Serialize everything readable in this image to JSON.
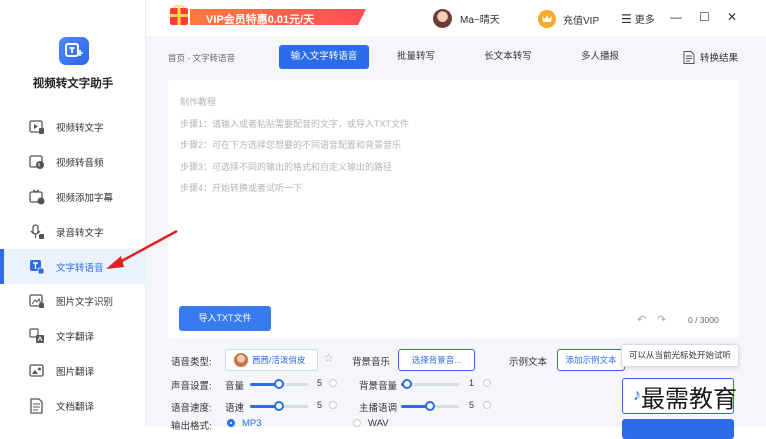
{
  "app": {
    "name": "视频转文字助手"
  },
  "sidebar": {
    "items": [
      {
        "label": "视频转文字",
        "icon": "video-text-icon"
      },
      {
        "label": "视频转音频",
        "icon": "video-audio-icon"
      },
      {
        "label": "视频添加字幕",
        "icon": "subtitle-icon"
      },
      {
        "label": "录音转文字",
        "icon": "microphone-icon"
      },
      {
        "label": "文字转语音",
        "icon": "text-to-speech-icon",
        "active": true
      },
      {
        "label": "图片文字识别",
        "icon": "image-ocr-icon"
      },
      {
        "label": "文字翻译",
        "icon": "translate-icon"
      },
      {
        "label": "图片翻译",
        "icon": "image-translate-icon"
      },
      {
        "label": "文档翻译",
        "icon": "document-icon"
      }
    ]
  },
  "topbar": {
    "vip_banner": "VIP会员特惠0.01元/天",
    "username": "Ma~晴天",
    "buy_vip": "充值VIP",
    "more": "更多"
  },
  "breadcrumb": "首页 - 文字转语音",
  "tabs": [
    "输入文字转语音",
    "批量转写",
    "长文本转写",
    "多人播报"
  ],
  "result_label": "转换结果",
  "editor": {
    "hints": [
      "制作教程",
      "步骤1：请输入或者粘贴需要配音的文字，或导入TXT文件",
      "步骤2：可在下方选择您想要的不同语音配置和背景音乐",
      "步骤3：可选择不同的输出的格式和自定义输出的路径",
      "步骤4：开始转换或者试听一下"
    ],
    "import_label": "导入TXT文件",
    "counter": "0 / 3000"
  },
  "settings": {
    "voice_type_label": "语音类型:",
    "voice_name": "茜茜/活泼俏皮",
    "bg_music_label": "背景音乐",
    "bg_music_button": "选择背景音...",
    "example_label": "示例文本",
    "example_button": "添加示例文本",
    "tip": "可以从当前光标处开始试听",
    "sound_label": "声音设置:",
    "volume_label": "音量",
    "volume_value": "5",
    "volume_level": 0.5,
    "bg_volume_label": "背景音量",
    "bg_volume_value": "1",
    "bg_volume_level": 0.1,
    "speed_label": "语音速度:",
    "speed_sub_label": "语速",
    "speed_value": "5",
    "speed_level": 0.5,
    "pitch_label": "主播语调",
    "pitch_value": "5",
    "pitch_level": 0.5,
    "format_label": "输出格式:",
    "formats": [
      "MP3",
      "WAV"
    ],
    "selected_format": "MP3"
  },
  "watermark": "最需教育",
  "colors": {
    "accent": "#2b6de8",
    "vip": "#ff5a4e"
  }
}
